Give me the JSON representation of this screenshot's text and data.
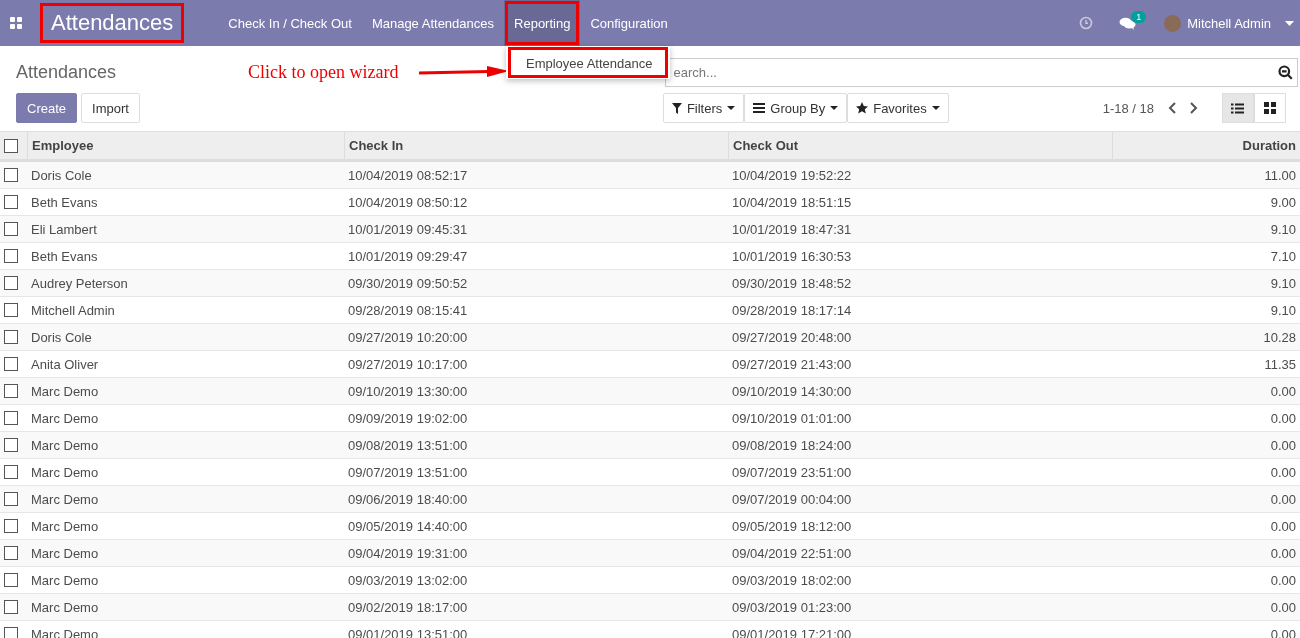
{
  "navbar": {
    "app_title": {
      "text": "Attendances",
      "highlighted": true
    },
    "menu": [
      {
        "label": "Check In / Check Out",
        "selected": false,
        "highlighted": false
      },
      {
        "label": "Manage Attendances",
        "selected": false,
        "highlighted": false
      },
      {
        "label": "Reporting",
        "selected": true,
        "highlighted": true
      },
      {
        "label": "Configuration",
        "selected": false,
        "highlighted": false
      }
    ],
    "messages_badge": "1",
    "user": "Mitchell Admin"
  },
  "dropdown": {
    "items": [
      {
        "label": "Employee Attendance",
        "highlighted": true
      }
    ]
  },
  "annotation": {
    "text": "Click to open wizard"
  },
  "breadcrumb": "Attendances",
  "buttons": {
    "create": "Create",
    "import": "Import"
  },
  "search": {
    "placeholder": "earch..."
  },
  "filters": [
    "Filters",
    "Group By",
    "Favorites"
  ],
  "pager": "1-18 / 18",
  "views": [
    {
      "kind": "list",
      "selected": true
    },
    {
      "kind": "kanban",
      "selected": false
    }
  ],
  "table": {
    "columns": [
      "Employee",
      "Check In",
      "Check Out",
      "Duration"
    ],
    "select_all_checked": false,
    "rows_checked": [
      false,
      false,
      false,
      false,
      false,
      false,
      false,
      false,
      false,
      false,
      false,
      false,
      false,
      false,
      false,
      false,
      false,
      false
    ],
    "rows": [
      [
        "Doris Cole",
        "10/04/2019 08:52:17",
        "10/04/2019 19:52:22",
        "11.00"
      ],
      [
        "Beth Evans",
        "10/04/2019 08:50:12",
        "10/04/2019 18:51:15",
        "9.00"
      ],
      [
        "Eli Lambert",
        "10/01/2019 09:45:31",
        "10/01/2019 18:47:31",
        "9.10"
      ],
      [
        "Beth Evans",
        "10/01/2019 09:29:47",
        "10/01/2019 16:30:53",
        "7.10"
      ],
      [
        "Audrey Peterson",
        "09/30/2019 09:50:52",
        "09/30/2019 18:48:52",
        "9.10"
      ],
      [
        "Mitchell Admin",
        "09/28/2019 08:15:41",
        "09/28/2019 18:17:14",
        "9.10"
      ],
      [
        "Doris Cole",
        "09/27/2019 10:20:00",
        "09/27/2019 20:48:00",
        "10.28"
      ],
      [
        "Anita Oliver",
        "09/27/2019 10:17:00",
        "09/27/2019 21:43:00",
        "11.35"
      ],
      [
        "Marc Demo",
        "09/10/2019 13:30:00",
        "09/10/2019 14:30:00",
        "0.00"
      ],
      [
        "Marc Demo",
        "09/09/2019 19:02:00",
        "09/10/2019 01:01:00",
        "0.00"
      ],
      [
        "Marc Demo",
        "09/08/2019 13:51:00",
        "09/08/2019 18:24:00",
        "0.00"
      ],
      [
        "Marc Demo",
        "09/07/2019 13:51:00",
        "09/07/2019 23:51:00",
        "0.00"
      ],
      [
        "Marc Demo",
        "09/06/2019 18:40:00",
        "09/07/2019 00:04:00",
        "0.00"
      ],
      [
        "Marc Demo",
        "09/05/2019 14:40:00",
        "09/05/2019 18:12:00",
        "0.00"
      ],
      [
        "Marc Demo",
        "09/04/2019 19:31:00",
        "09/04/2019 22:51:00",
        "0.00"
      ],
      [
        "Marc Demo",
        "09/03/2019 13:02:00",
        "09/03/2019 18:02:00",
        "0.00"
      ],
      [
        "Marc Demo",
        "09/02/2019 18:17:00",
        "09/03/2019 01:23:00",
        "0.00"
      ],
      [
        "Marc Demo",
        "09/01/2019 13:51:00",
        "09/01/2019 17:21:00",
        "0.00"
      ]
    ]
  }
}
